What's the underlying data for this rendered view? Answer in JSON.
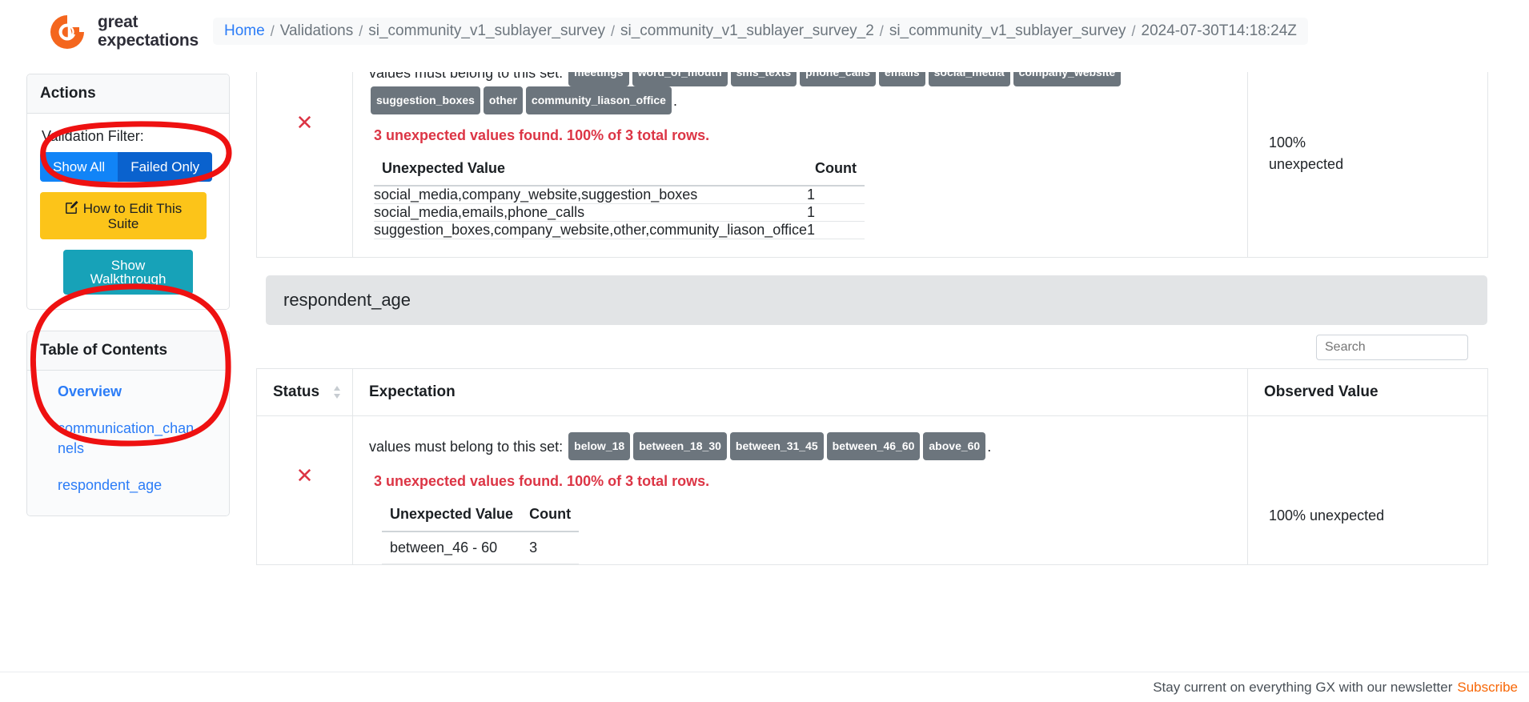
{
  "brand": {
    "line1": "great",
    "line2": "expectations",
    "logo_icon": "great-expectations-logo-icon",
    "accent_color": "#f4661e"
  },
  "breadcrumb": {
    "home": "Home",
    "separator": "/",
    "items": [
      "Validations",
      "si_community_v1_sublayer_survey",
      "si_community_v1_sublayer_survey_2",
      "si_community_v1_sublayer_survey",
      "2024-07-30T14:18:24Z"
    ]
  },
  "sidebar": {
    "actions": {
      "title": "Actions",
      "filter_label": "Validation Filter:",
      "show_all": "Show All",
      "failed_only": "Failed Only",
      "edit_suite": "How to Edit This Suite",
      "edit_icon": "pencil-square-icon",
      "walkthrough": "Show Walkthrough",
      "show_all_color": "#1184f7",
      "failed_only_color": "#0a62ce",
      "edit_color": "#fcc419",
      "walkthrough_color": "#17a2b8"
    },
    "toc": {
      "title": "Table of Contents",
      "links": [
        {
          "label": "Overview",
          "active": true
        },
        {
          "label": "communication_channels",
          "active": false
        },
        {
          "label": "respondent_age",
          "active": false
        }
      ]
    }
  },
  "main": {
    "partial_header": "bserved Value",
    "sections": [
      {
        "id": "communication_channels",
        "status_icon": "x-mark-icon",
        "expectation_prefix": "values must belong to this set:",
        "expectation_suffix": ".",
        "value_set": [
          "meetings",
          "word_of_mouth",
          "sms_texts",
          "phone_calls",
          "emails",
          "social_media",
          "company_website",
          "suggestion_boxes",
          "other",
          "community_liason_office"
        ],
        "unexpected_message": "3 unexpected values found. 100% of 3 total rows.",
        "unexpected_table": {
          "headers": [
            "Unexpected Value",
            "Count"
          ],
          "rows": [
            [
              "social_media,company_website,suggestion_boxes",
              "1"
            ],
            [
              "social_media,emails,phone_calls",
              "1"
            ],
            [
              "suggestion_boxes,company_website,other,community_liason_office",
              "1"
            ]
          ]
        },
        "observed_value": "100% unexpected"
      }
    ],
    "respondent_section": {
      "title": "respondent_age",
      "search_placeholder": "Search",
      "search_icon": "search-icon",
      "columns": [
        {
          "label": "Status",
          "sortable": true,
          "sort_icon": "sort-arrows-icon"
        },
        {
          "label": "Expectation",
          "sortable": false
        },
        {
          "label": "Observed Value",
          "sortable": false
        }
      ],
      "row": {
        "status_icon": "x-mark-icon",
        "expectation_prefix": "values must belong to this set:",
        "expectation_suffix": ".",
        "value_set": [
          "below_18",
          "between_18_30",
          "between_31_45",
          "between_46_60",
          "above_60"
        ],
        "unexpected_message": "3 unexpected values found. 100% of 3 total rows.",
        "unexpected_table": {
          "headers": [
            "Unexpected Value",
            "Count"
          ],
          "rows": [
            [
              "between_46 - 60",
              "3"
            ]
          ]
        },
        "observed_value": "100% unexpected"
      }
    }
  },
  "footer": {
    "text": "Stay current on everything GX with our newsletter",
    "link": "Subscribe",
    "link_color": "#f76707"
  },
  "annotations": {
    "color": "#ee1111",
    "shapes": [
      "validation-filter-ellipse",
      "table-of-contents-ellipse"
    ]
  }
}
